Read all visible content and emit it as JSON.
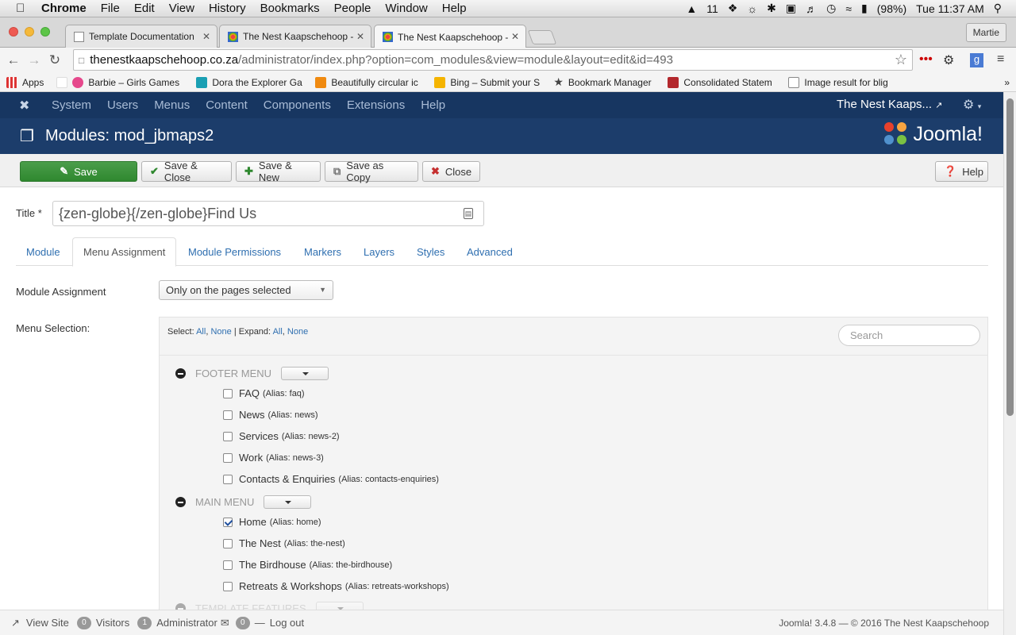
{
  "mac_menubar": {
    "items": [
      "Chrome",
      "File",
      "Edit",
      "View",
      "History",
      "Bookmarks",
      "People",
      "Window",
      "Help"
    ],
    "status": {
      "notifications": "11",
      "battery": "(98%)",
      "clock": "Tue 11:37 AM"
    }
  },
  "browser": {
    "tabs": [
      {
        "title": "Template Documentation"
      },
      {
        "title": "The Nest Kaapschehoop -"
      },
      {
        "title": "The Nest Kaapschehoop -"
      }
    ],
    "profile": "Martie",
    "url_host": "thenestkaapschehoop.co.za",
    "url_path": "/administrator/index.php?option=com_modules&view=module&layout=edit&id=493",
    "bookmarks": [
      "Apps",
      "Barbie – Girls Games",
      "Dora the Explorer Ga",
      "Beautifully circular ic",
      "Bing – Submit your S",
      "Bookmark Manager",
      "Consolidated Statem",
      "Image result for blig"
    ]
  },
  "joomla_nav": {
    "items": [
      "System",
      "Users",
      "Menus",
      "Content",
      "Components",
      "Extensions",
      "Help"
    ],
    "site_name": "The Nest Kaaps..."
  },
  "header": {
    "title": "Modules: mod_jbmaps2",
    "brand": "Joomla!"
  },
  "toolbar": {
    "save": "Save",
    "save_close": "Save & Close",
    "save_new": "Save & New",
    "save_copy": "Save as Copy",
    "close": "Close",
    "help": "Help"
  },
  "form": {
    "title_label": "Title *",
    "title_value": "{zen-globe}{/zen-globe}Find Us",
    "tabs": [
      "Module",
      "Menu Assignment",
      "Module Permissions",
      "Markers",
      "Layers",
      "Styles",
      "Advanced"
    ],
    "active_tab": "Menu Assignment",
    "assignment_label": "Module Assignment",
    "assignment_value": "Only on the pages selected",
    "menu_selection_label": "Menu Selection:",
    "select_prefix": "Select:",
    "expand_prefix": "Expand:",
    "all": "All",
    "none": "None",
    "search_placeholder": "Search"
  },
  "menus": [
    {
      "name": "FOOTER MENU",
      "items": [
        {
          "label": "FAQ",
          "alias": "(Alias: faq)",
          "checked": false
        },
        {
          "label": "News",
          "alias": "(Alias: news)",
          "checked": false
        },
        {
          "label": "Services",
          "alias": "(Alias: news-2)",
          "checked": false
        },
        {
          "label": "Work",
          "alias": "(Alias: news-3)",
          "checked": false
        },
        {
          "label": "Contacts & Enquiries",
          "alias": "(Alias: contacts-enquiries)",
          "checked": false
        }
      ]
    },
    {
      "name": "MAIN MENU",
      "items": [
        {
          "label": "Home",
          "alias": "(Alias: home)",
          "checked": true
        },
        {
          "label": "The Nest",
          "alias": "(Alias: the-nest)",
          "checked": false
        },
        {
          "label": "The Birdhouse",
          "alias": "(Alias: the-birdhouse)",
          "checked": false
        },
        {
          "label": "Retreats & Workshops",
          "alias": "(Alias: retreats-workshops)",
          "checked": false
        }
      ]
    },
    {
      "name": "TEMPLATE FEATURES",
      "items": []
    }
  ],
  "statusbar": {
    "view_site": "View Site",
    "visitors_count": "0",
    "visitors": "Visitors",
    "admin_count": "1",
    "admin": "Administrator",
    "msg_count": "0",
    "logout": "Log out",
    "version": "Joomla! 3.4.8",
    "copyright": "© 2016 The Nest Kaapschehoop"
  },
  "colors": {
    "nav": "#173661",
    "header": "#1c3d6b",
    "save": "#2f882f",
    "link": "#2f6fb0"
  }
}
